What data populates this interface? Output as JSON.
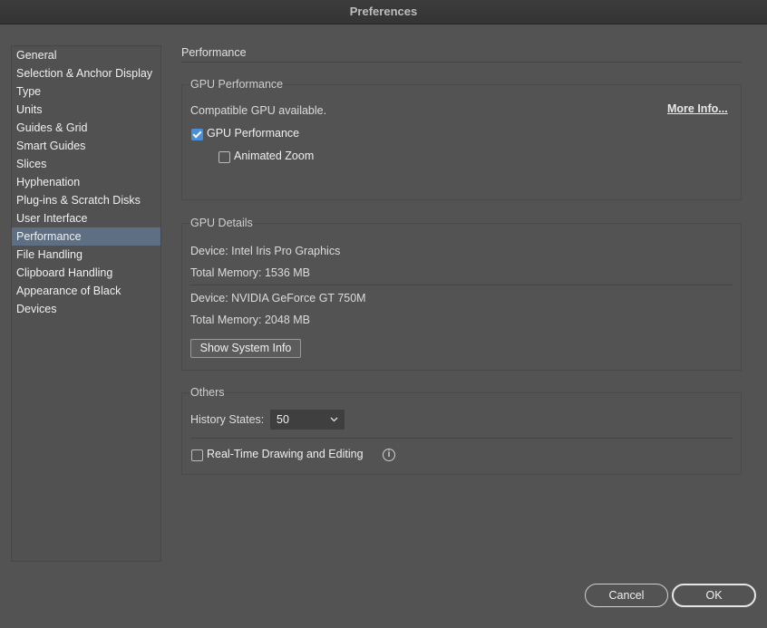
{
  "window": {
    "title": "Preferences"
  },
  "sidebar": {
    "items": [
      {
        "label": "General"
      },
      {
        "label": "Selection & Anchor Display"
      },
      {
        "label": "Type"
      },
      {
        "label": "Units"
      },
      {
        "label": "Guides & Grid"
      },
      {
        "label": "Smart Guides"
      },
      {
        "label": "Slices"
      },
      {
        "label": "Hyphenation"
      },
      {
        "label": "Plug-ins & Scratch Disks"
      },
      {
        "label": "User Interface"
      },
      {
        "label": "Performance"
      },
      {
        "label": "File Handling"
      },
      {
        "label": "Clipboard Handling"
      },
      {
        "label": "Appearance of Black"
      },
      {
        "label": "Devices"
      }
    ],
    "selected": "Performance"
  },
  "main": {
    "title": "Performance",
    "gpu_performance": {
      "title": "GPU Performance",
      "status": "Compatible GPU available.",
      "more_info": "More Info...",
      "gpu_checkbox": {
        "label": "GPU Performance",
        "checked": true
      },
      "zoom_checkbox": {
        "label": "Animated Zoom",
        "checked": false
      }
    },
    "gpu_details": {
      "title": "GPU Details",
      "devices": [
        {
          "device": "Device: Intel Iris Pro Graphics",
          "memory": "Total Memory: 1536 MB"
        },
        {
          "device": "Device: NVIDIA GeForce GT 750M",
          "memory": "Total Memory: 2048 MB"
        }
      ],
      "show_system_info": "Show System Info"
    },
    "others": {
      "title": "Others",
      "history_label": "History States:",
      "history_value": "50",
      "realtime_checkbox": {
        "label": "Real-Time Drawing and Editing",
        "checked": false
      },
      "info_icon": "i"
    }
  },
  "footer": {
    "cancel": "Cancel",
    "ok": "OK"
  },
  "colors": {
    "background": "#535353",
    "selection": "#5e6f84",
    "checkbox_accent": "#4a8fd6"
  }
}
